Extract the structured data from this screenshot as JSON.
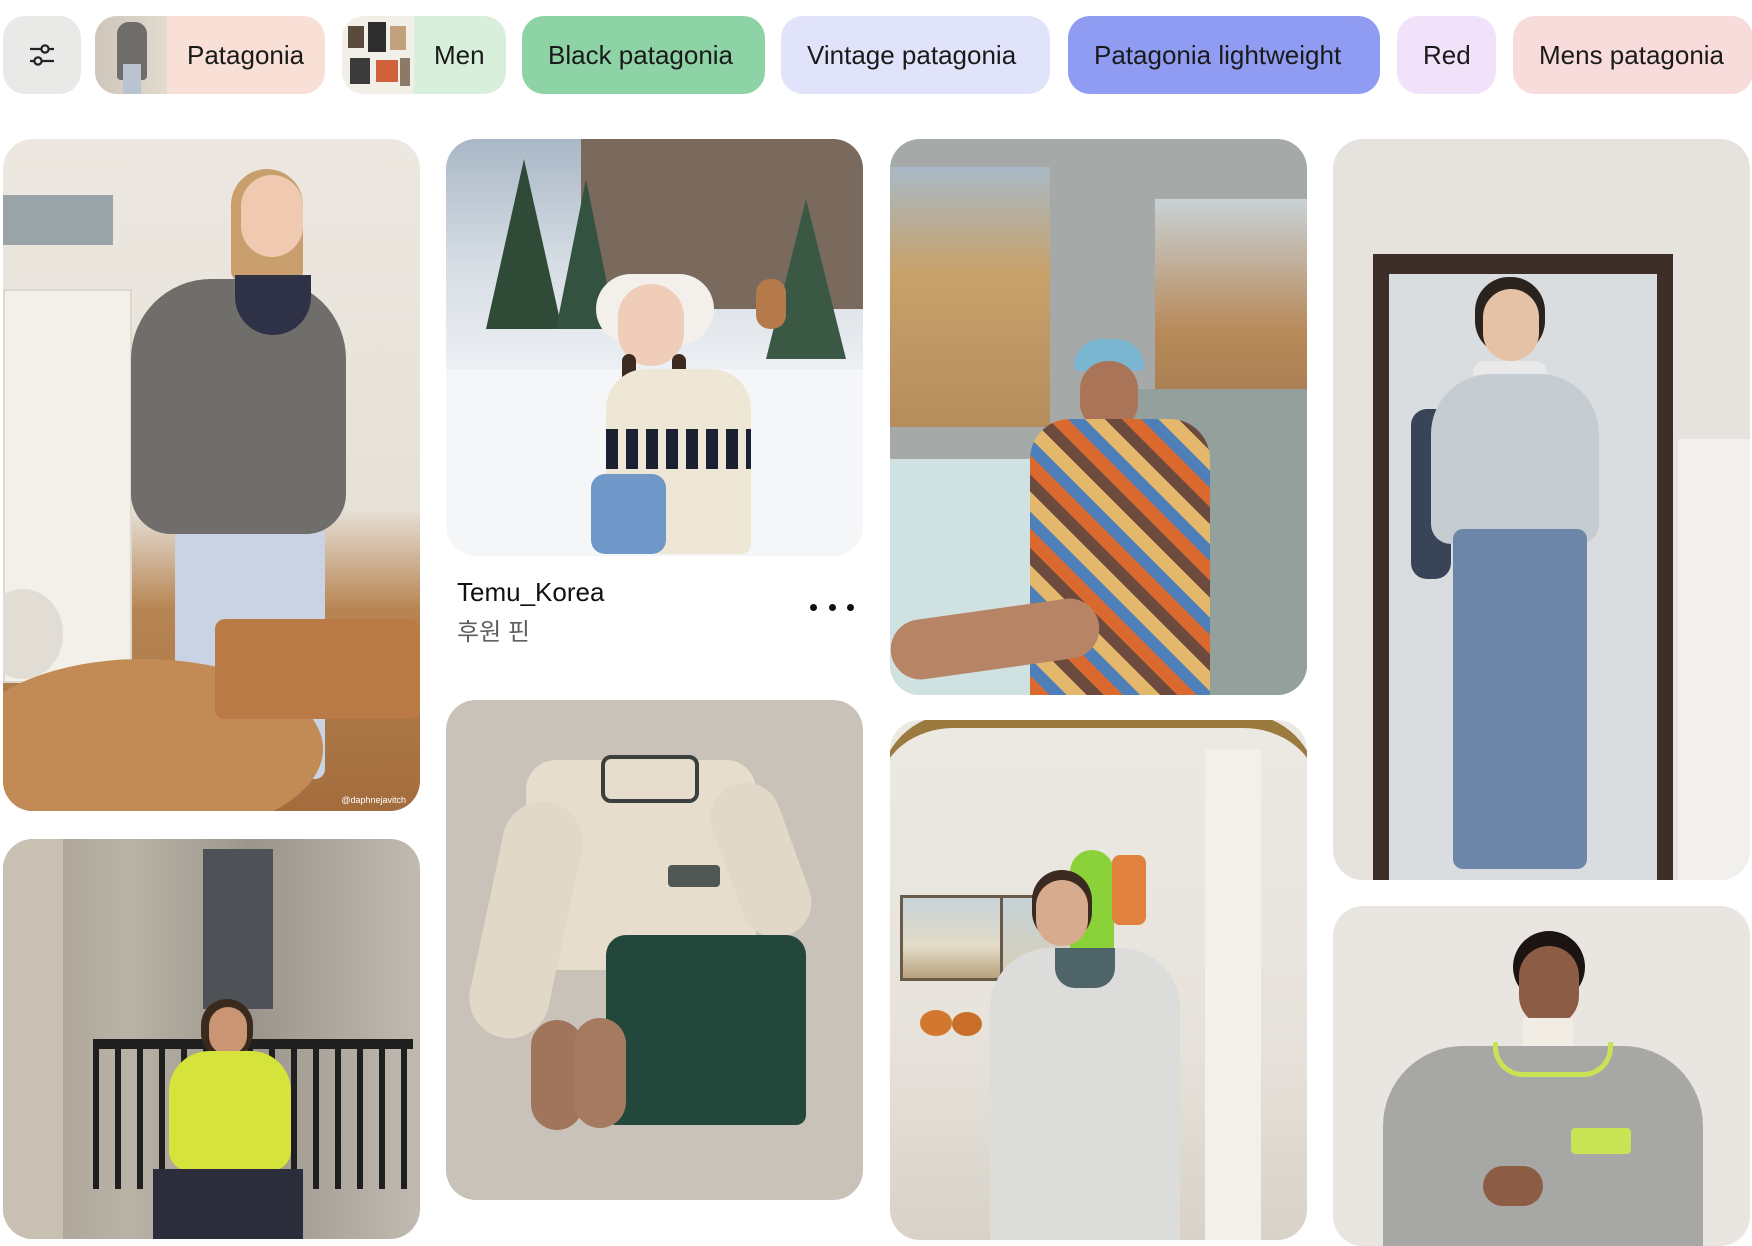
{
  "filters": {
    "icon": "sliders-icon",
    "chips": [
      {
        "label": "Patagonia",
        "bg": "#f8e0d6",
        "has_thumb": true
      },
      {
        "label": "Men",
        "bg": "#d8efdc",
        "has_thumb": true
      },
      {
        "label": "Black patagonia",
        "bg": "#8ed3a6",
        "has_thumb": false
      },
      {
        "label": "Vintage patagonia",
        "bg": "#e1e3fb",
        "has_thumb": false
      },
      {
        "label": "Patagonia lightweight",
        "bg": "#8f9cf2",
        "has_thumb": false
      },
      {
        "label": "Red",
        "bg": "#f1e2fa",
        "has_thumb": false
      },
      {
        "label": "Mens patagonia",
        "bg": "#f8dcdc",
        "has_thumb": false
      }
    ]
  },
  "pins": {
    "promoted": {
      "title": "Temu_Korea",
      "subtitle": "후원 핀",
      "more_icon": "ellipsis-icon"
    },
    "watermark": "@daphnejavitch"
  }
}
